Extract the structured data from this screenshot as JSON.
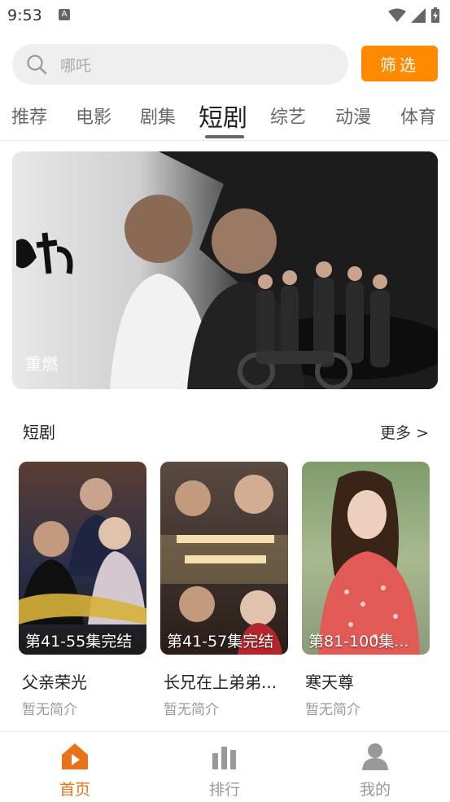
{
  "status_bar": {
    "time": "9:53",
    "notification_icon": "A"
  },
  "search": {
    "placeholder": "哪吒",
    "filter_label": "筛选"
  },
  "tabs": [
    {
      "label": "推荐"
    },
    {
      "label": "电影"
    },
    {
      "label": "剧集"
    },
    {
      "label": "短剧"
    },
    {
      "label": "综艺"
    },
    {
      "label": "动漫"
    },
    {
      "label": "体育"
    }
  ],
  "banner": {
    "caption": "重燃"
  },
  "section": {
    "title": "短剧",
    "more_label": "更多 >"
  },
  "cards": [
    {
      "title": "父亲荣光",
      "episodes": "第41-55集完结",
      "desc": "暂无简介"
    },
    {
      "title": "长兄在上弟弟...",
      "episodes": "第41-57集完结",
      "desc": "暂无简介"
    },
    {
      "title": "寒天尊",
      "episodes": "第81-100集...",
      "desc": "暂无简介"
    }
  ],
  "bottom_nav": [
    {
      "label": "首页",
      "icon": "home-icon"
    },
    {
      "label": "排行",
      "icon": "ranking-icon"
    },
    {
      "label": "我的",
      "icon": "user-icon"
    }
  ],
  "colors": {
    "accent": "#ff8a00",
    "nav_active": "#e8721a"
  }
}
